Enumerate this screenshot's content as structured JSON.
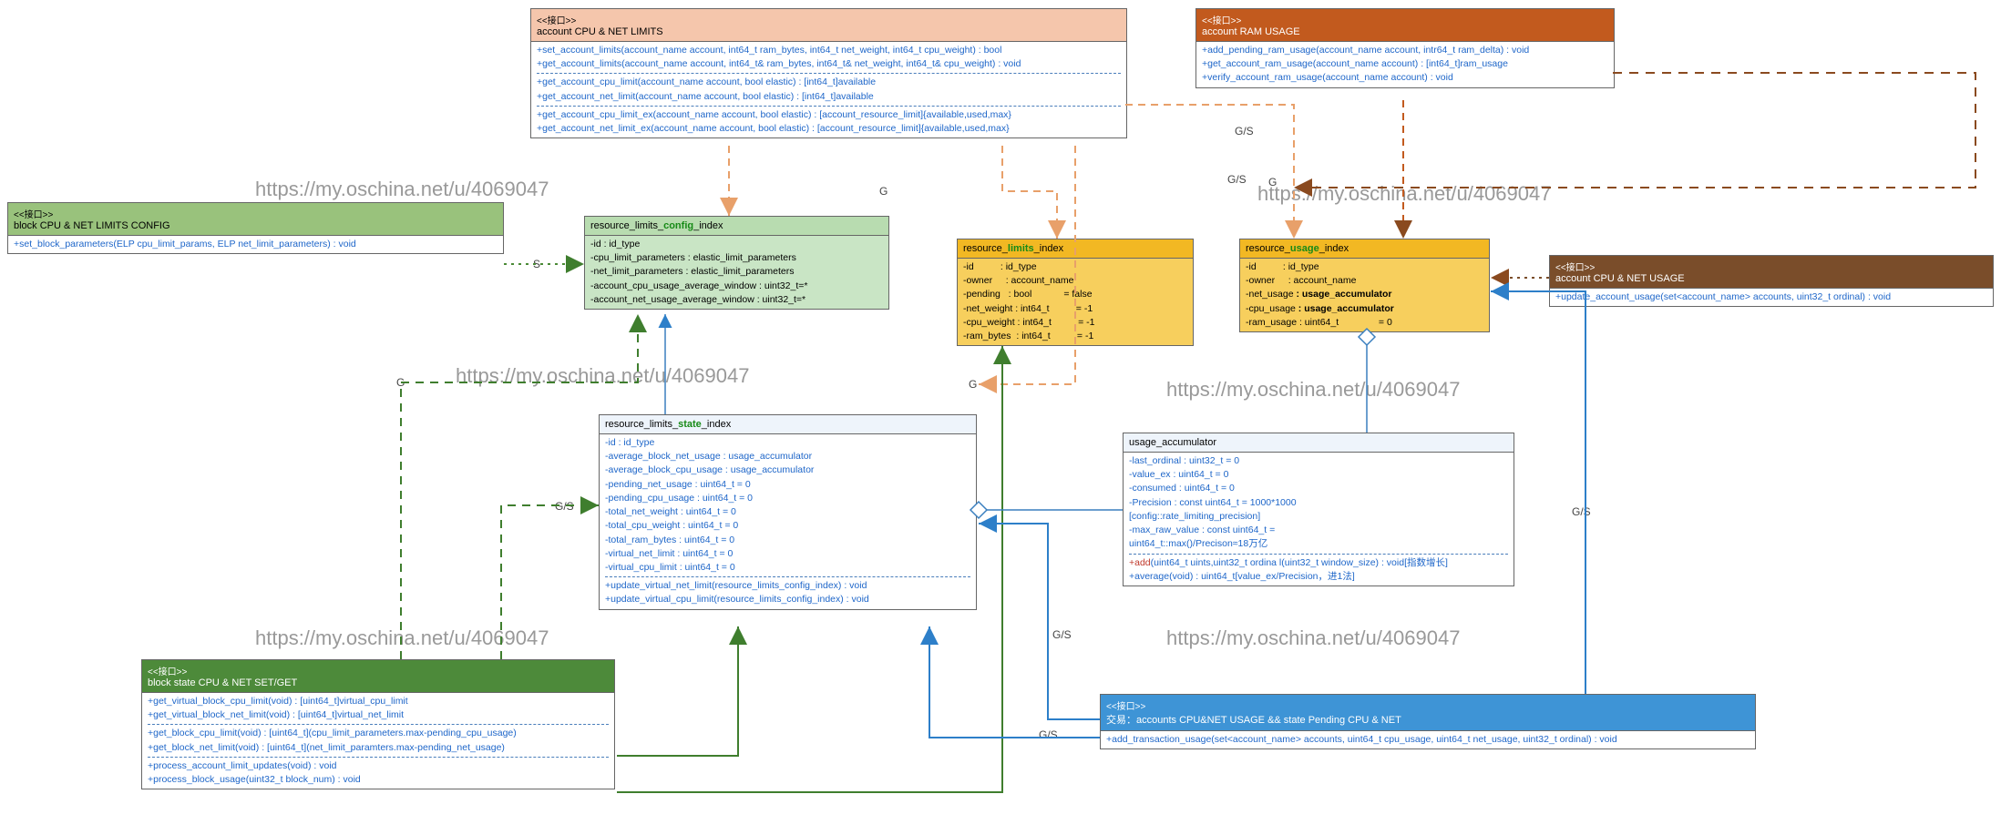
{
  "watermark": "https://my.oschina.net/u/4069047",
  "boxes": {
    "cpuNetLimits": {
      "stereo": "<<接口>>",
      "title": "account CPU & NET LIMITS",
      "m0": "+set_account_limits(account_name account, int64_t ram_bytes, int64_t net_weight, int64_t cpu_weight) : bool",
      "m1": "+get_account_limits(account_name account, int64_t& ram_bytes, int64_t& net_weight, int64_t& cpu_weight) : void",
      "m2": "+get_account_cpu_limit(account_name account, bool elastic) : [int64_t]available",
      "m3": "+get_account_net_limit(account_name account, bool elastic) : [int64_t]available",
      "m4": "+get_account_cpu_limit_ex(account_name account, bool elastic) : [account_resource_limit]{available,used,max}",
      "m5": "+get_account_net_limit_ex(account_name account, bool elastic) : [account_resource_limit]{available,used,max}"
    },
    "ramUsage": {
      "stereo": "<<接口>>",
      "title": "account RAM USAGE",
      "m0": "+add_pending_ram_usage(account_name account, intr64_t ram_delta) : void",
      "m1": "+get_account_ram_usage(account_name account) : [int64_t]ram_usage",
      "m2": "+verify_account_ram_usage(account_name account) : void"
    },
    "blockConfig": {
      "stereo": "<<接口>>",
      "title": "block CPU & NET LIMITS CONFIG",
      "m0": "+set_block_parameters(ELP cpu_limit_params, ELP net_limit_parameters) : void"
    },
    "cpuNetUsage": {
      "stereo": "<<接口>>",
      "title": "account CPU & NET USAGE",
      "m0": "+update_account_usage(set<account_name> accounts, uint32_t ordinal) : void"
    },
    "configIndex": {
      "title_pre": "resource_limits_",
      "title_mid": "config",
      "title_post": "_index",
      "r0": "-id                        : id_type",
      "r1": "-cpu_limit_parameters : elastic_limit_parameters",
      "r2": "-net_limit_parameters : elastic_limit_parameters",
      "r3": "-account_cpu_usage_average_window : uint32_t=*",
      "r4": "-account_net_usage_average_window : uint32_t=*"
    },
    "limitsIndex": {
      "title_pre": "resource_",
      "title_mid": "limits",
      "title_post": "_index",
      "r0l": "-id",
      "r0r": ": id_type",
      "r1l": "-owner",
      "r1r": ": account_name",
      "r2l": "-pending",
      "r2r": ": bool",
      "r2v": "= false",
      "r3l": "-net_weight",
      "r3r": ": int64_t",
      "r3v": "= -1",
      "r4l": "-cpu_weight",
      "r4r": ": int64_t",
      "r4v": "= -1",
      "r5l": "-ram_bytes",
      "r5r": ": int64_t",
      "r5v": "= -1"
    },
    "usageIndex": {
      "title_pre": "resource_",
      "title_mid": "usage",
      "title_post": "_index",
      "r0l": "-id",
      "r0r": ": id_type",
      "r1l": "-owner",
      "r1r": ": account_name",
      "r2l": "-net_usage",
      "r2b": ": usage_accumulator",
      "r3l": "-cpu_usage",
      "r3b": ": usage_accumulator",
      "r4l": "-ram_usage",
      "r4r": ": uint64_t",
      "r4v": "= 0"
    },
    "stateIndex": {
      "title_pre": "resource_limits_",
      "title_mid": "state",
      "title_post": "_index",
      "r0": "-id                               : id_type",
      "r1": "-average_block_net_usage : usage_accumulator",
      "r2": "-average_block_cpu_usage : usage_accumulator",
      "r3": "-pending_net_usage         : uint64_t = 0",
      "r4": "-pending_cpu_usage         : uint64_t = 0",
      "r5": "-total_net_weight            : uint64_t = 0",
      "r6": "-total_cpu_weight            : uint64_t = 0",
      "r7": "-total_ram_bytes             : uint64_t = 0",
      "r8": "-virtual_net_limit            : uint64_t = 0",
      "r9": "-virtual_cpu_limit           : uint64_t = 0",
      "m0": "+update_virtual_net_limit(resource_limits_config_index) : void",
      "m1": "+update_virtual_cpu_limit(resource_limits_config_index) : void"
    },
    "accumulator": {
      "title": "usage_accumulator",
      "r0": "-last_ordinal : uint32_t = 0",
      "r1": "-value_ex      : uint64_t = 0",
      "r2": "-consumed    : uint64_t = 0",
      "r3": "-Precision     : const uint64_t = 1000*1000",
      "r3b": "                      [config::rate_limiting_precision]",
      "r4": "-max_raw_value : const uint64_t =",
      "r4b": "                      uint64_t::max()/Precison≈18万亿",
      "m0a": "+add",
      "m0b": "(uint64_t uints,uint32_t ordina l(uint32_t window_size) : void[指数增长]",
      "m1": "+average(void) : uint64_t[value_ex/Precision，进1法]"
    },
    "blockState": {
      "stereo": "<<接口>>",
      "title": "block state CPU & NET SET/GET",
      "m0": "+get_virtual_block_cpu_limit(void) : [uint64_t]virtual_cpu_limit",
      "m1": "+get_virtual_block_net_limit(void) : [uint64_t]virtual_net_limit",
      "m2": "+get_block_cpu_limit(void) : [uint64_t](cpu_limit_parameters.max-pending_cpu_usage)",
      "m3": "+get_block_net_limit(void) : [uint64_t](net_limit_paramters.max-pending_net_usage)",
      "m4": "+process_account_limit_updates(void) : void",
      "m5": "+process_block_usage(uint32_t block_num) : void"
    },
    "transaction": {
      "stereo": "<<接口>>",
      "title": "交易：accounts CPU&NET USAGE && state Pending CPU & NET",
      "m0": "+add_transaction_usage(set<account_name> accounts, uint64_t cpu_usage, uint64_t net_usage, uint32_t ordinal) : void"
    }
  },
  "labels": {
    "gs": "G/S",
    "g": "G",
    "s": "S"
  }
}
